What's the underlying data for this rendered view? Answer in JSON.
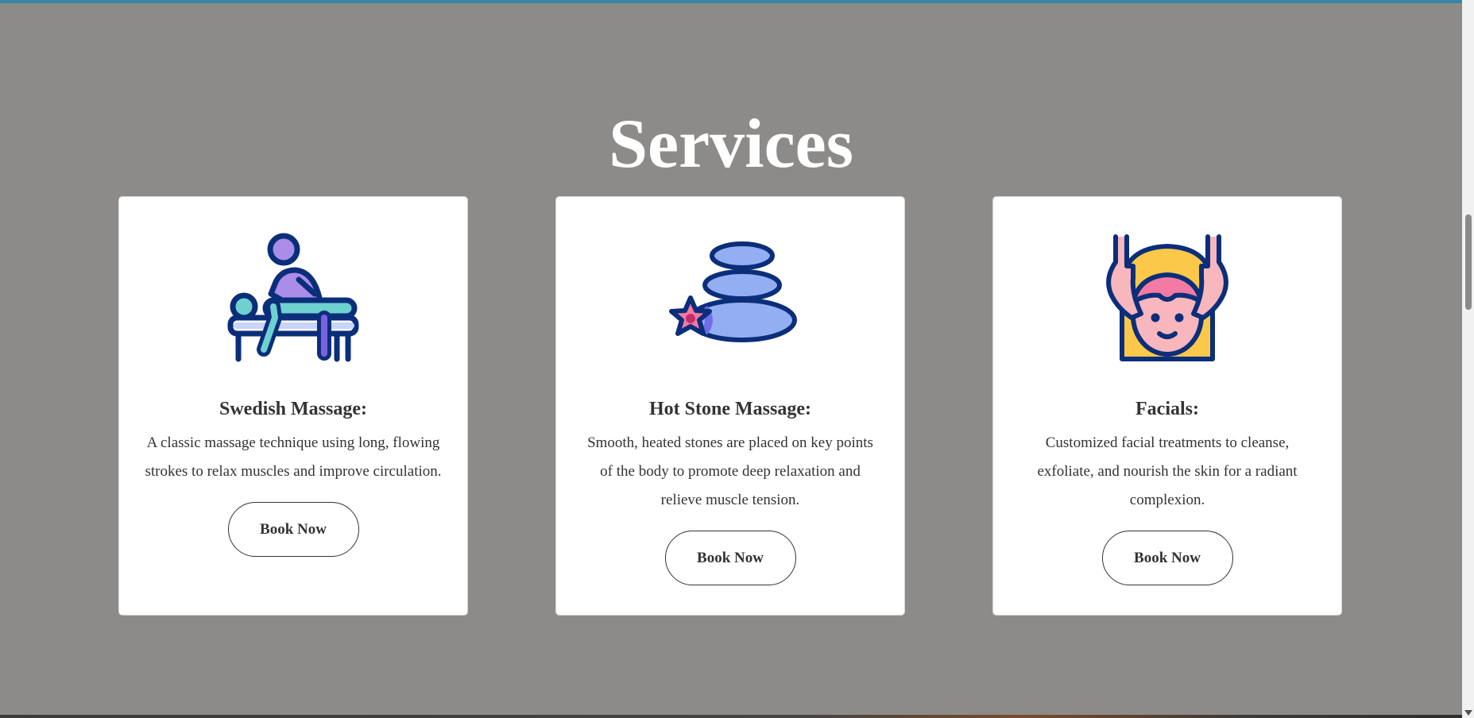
{
  "section": {
    "title": "Services"
  },
  "services": [
    {
      "icon": "massage-icon",
      "name": "Swedish Massage:",
      "description": "A classic massage technique using long, flowing strokes to relax muscles and improve circulation.",
      "button": "Book Now"
    },
    {
      "icon": "hot-stones-icon",
      "name": "Hot Stone Massage:",
      "description": "Smooth, heated stones are placed on key points of the body to promote deep relaxation and relieve muscle tension.",
      "button": "Book Now"
    },
    {
      "icon": "facial-icon",
      "name": "Facials:",
      "description": "Customized facial treatments to cleanse, exfoliate, and nourish the skin for a radiant complexion.",
      "button": "Book Now"
    }
  ],
  "colors": {
    "background": "#8c8b89",
    "accent_bar": "#3a86a5",
    "icon_outline": "#0b2e7a",
    "icon_purple": "#a98de8",
    "icon_teal": "#6fd0d0",
    "icon_blue": "#93aef2",
    "icon_pink": "#f37aa3",
    "icon_yellow": "#fbc84a",
    "icon_skin": "#f8b6bd"
  }
}
